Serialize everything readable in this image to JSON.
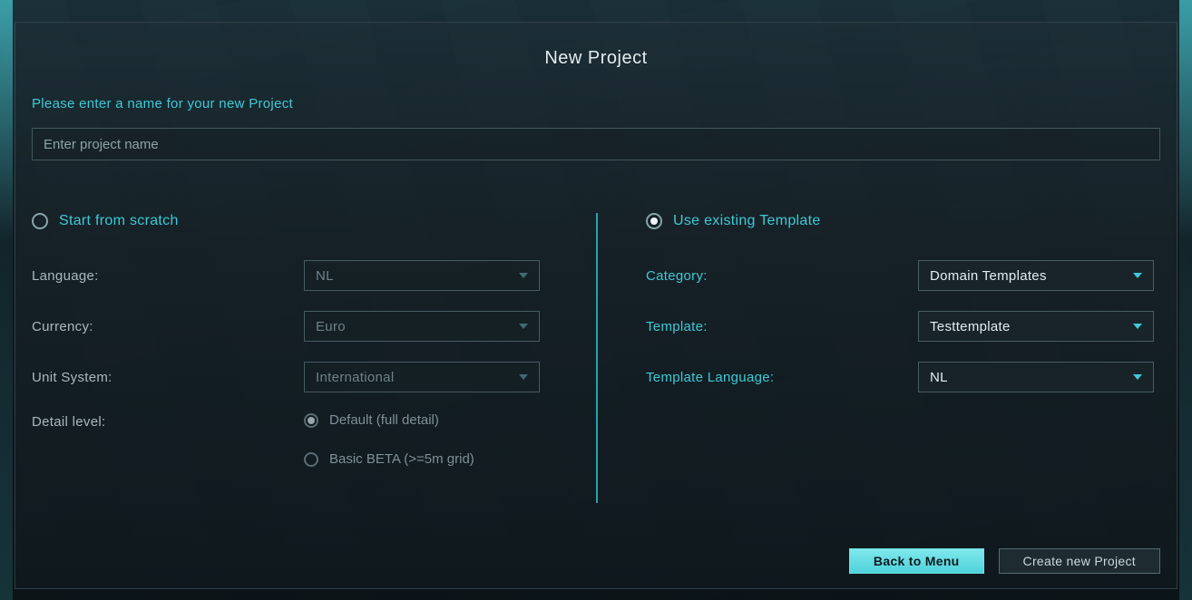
{
  "title": "New Project",
  "prompt": "Please enter a name for your new Project",
  "projectName": {
    "value": "",
    "placeholder": "Enter project name"
  },
  "left": {
    "optionLabel": "Start from scratch",
    "selected": false,
    "fields": {
      "languageLabel": "Language:",
      "languageValue": "NL",
      "currencyLabel": "Currency:",
      "currencyValue": "Euro",
      "unitLabel": "Unit System:",
      "unitValue": "International",
      "detailLabel": "Detail level:",
      "detailDefault": "Default (full detail)",
      "detailBasic": "Basic BETA (>=5m grid)"
    }
  },
  "right": {
    "optionLabel": "Use existing Template",
    "selected": true,
    "fields": {
      "categoryLabel": "Category:",
      "categoryValue": "Domain Templates",
      "templateLabel": "Template:",
      "templateValue": "Testtemplate",
      "tlangLabel": "Template Language:",
      "tlangValue": "NL"
    }
  },
  "footer": {
    "back": "Back to Menu",
    "create": "Create new Project"
  }
}
